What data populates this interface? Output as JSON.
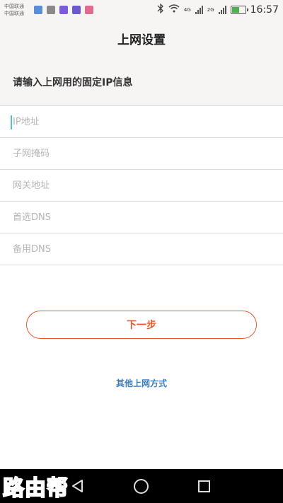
{
  "status_bar": {
    "carrier_1": "中国联通",
    "carrier_2": "中国联通",
    "network_1": "4G",
    "network_2": "2G",
    "time": "16:57",
    "icons": [
      "bluetooth-icon",
      "wifi-icon",
      "signal-icon",
      "battery-icon"
    ]
  },
  "header": {
    "title": "上网设置"
  },
  "instruction": "请输入上网用的固定IP信息",
  "form": {
    "ip_address_placeholder": "IP地址",
    "subnet_mask_placeholder": "子网掩码",
    "gateway_placeholder": "网关地址",
    "primary_dns_placeholder": "首选DNS",
    "secondary_dns_placeholder": "备用DNS"
  },
  "actions": {
    "next_label": "下一步",
    "other_methods_label": "其他上网方式"
  },
  "watermark": "路由帮",
  "colors": {
    "accent": "#e8582a",
    "link": "#3a7ec1",
    "caret": "#4fc3c8",
    "background": "#f7f5f3"
  }
}
